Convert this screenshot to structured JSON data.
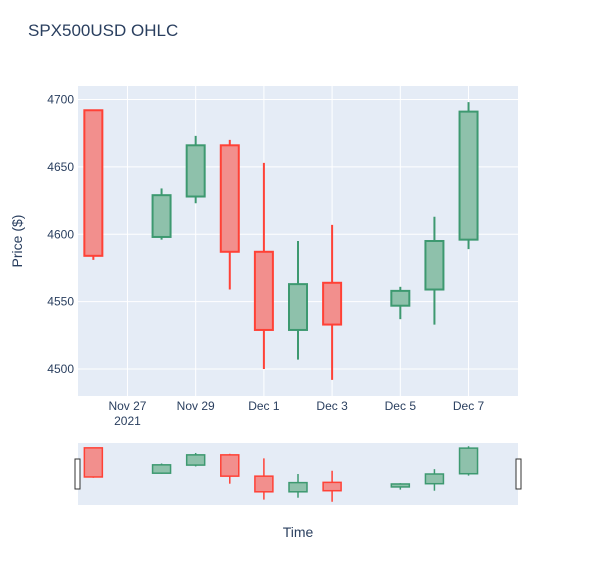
{
  "chart_data": {
    "type": "candlestick",
    "title": "SPX500USD OHLC",
    "xlabel": "Time",
    "ylabel": "Price ($)",
    "ylim": [
      4480,
      4710
    ],
    "yticks": [
      4500,
      4550,
      4600,
      4650,
      4700
    ],
    "grid": true,
    "x_range": [
      "2021-11-26",
      "2021-12-08"
    ],
    "xticks": [
      {
        "date": "2021-11-27",
        "label": "Nov 27",
        "sublabel": "2021"
      },
      {
        "date": "2021-11-29",
        "label": "Nov 29"
      },
      {
        "date": "2021-12-01",
        "label": "Dec 1"
      },
      {
        "date": "2021-12-03",
        "label": "Dec 3"
      },
      {
        "date": "2021-12-05",
        "label": "Dec 5"
      },
      {
        "date": "2021-12-07",
        "label": "Dec 7"
      }
    ],
    "candles": [
      {
        "date": "2021-11-26",
        "open": 4692,
        "high": 4692,
        "low": 4581,
        "close": 4584
      },
      {
        "date": "2021-11-28",
        "open": 4598,
        "high": 4634,
        "low": 4596,
        "close": 4629
      },
      {
        "date": "2021-11-29",
        "open": 4628,
        "high": 4673,
        "low": 4623,
        "close": 4666
      },
      {
        "date": "2021-11-30",
        "open": 4666,
        "high": 4670,
        "low": 4559,
        "close": 4587
      },
      {
        "date": "2021-12-01",
        "open": 4587,
        "high": 4653,
        "low": 4500,
        "close": 4529
      },
      {
        "date": "2021-12-02",
        "open": 4529,
        "high": 4595,
        "low": 4507,
        "close": 4563
      },
      {
        "date": "2021-12-03",
        "open": 4564,
        "high": 4607,
        "low": 4492,
        "close": 4533
      },
      {
        "date": "2021-12-05",
        "open": 4547,
        "high": 4561,
        "low": 4537,
        "close": 4558
      },
      {
        "date": "2021-12-06",
        "open": 4559,
        "high": 4613,
        "low": 4533,
        "close": 4595
      },
      {
        "date": "2021-12-07",
        "open": 4596,
        "high": 4698,
        "low": 4589,
        "close": 4691
      }
    ],
    "colors": {
      "increasing": "#3D9970",
      "increasing_fill": "#8EC1AB",
      "decreasing": "#FF4136",
      "decreasing_fill": "#F28F8D",
      "plot_bg": "#E5ECF6",
      "grid": "#ffffff",
      "text": "#2a3f5f",
      "title": "#2a3f5f"
    },
    "rangeslider": true
  }
}
